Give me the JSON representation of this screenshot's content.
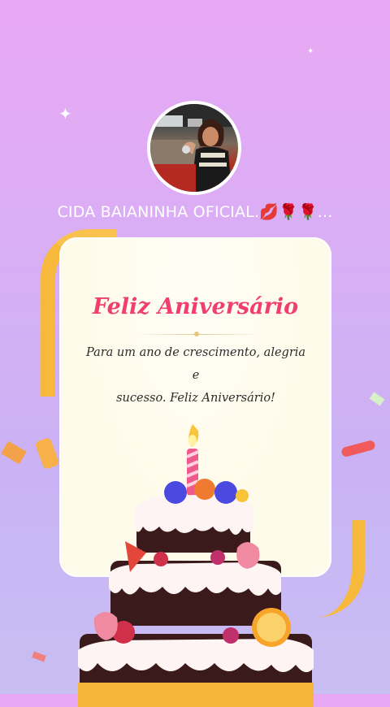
{
  "profile": {
    "username": "CIDA BAIANINHA OFICIAL.💋🌹🌹..."
  },
  "card": {
    "title": "Feliz Aniversário",
    "message_line1": "Para um ano de crescimento, alegria e",
    "message_line2": "sucesso. Feliz Aniversário!"
  },
  "colors": {
    "background_top": "#e9a8f3",
    "background_bottom": "#c8bff3",
    "title_color": "#f03e6e",
    "card_background": "#fffbea",
    "ribbon": "#f6b93b"
  }
}
